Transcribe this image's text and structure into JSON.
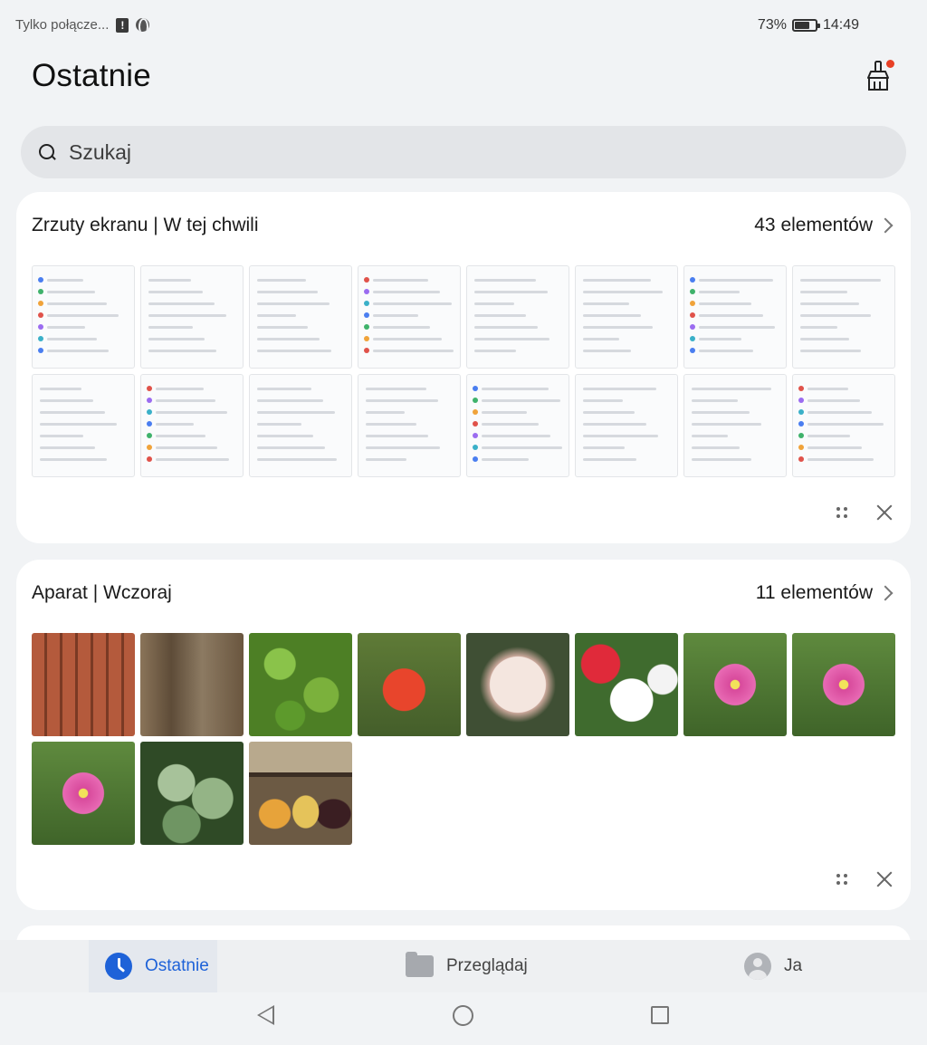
{
  "status_bar": {
    "carrier": "Tylko połącze...",
    "battery_percent": "73%",
    "battery_level": 0.73,
    "time": "14:49"
  },
  "header": {
    "title": "Ostatnie"
  },
  "search": {
    "placeholder": "Szukaj"
  },
  "albums": [
    {
      "title": "Zrzuty ekranu | W tej chwili",
      "count": "43 elementów",
      "thumbnails": [
        "screenshot",
        "screenshot",
        "screenshot",
        "screenshot",
        "screenshot",
        "screenshot",
        "screenshot",
        "screenshot",
        "screenshot",
        "screenshot",
        "screenshot",
        "screenshot",
        "screenshot",
        "screenshot",
        "screenshot",
        "screenshot"
      ]
    },
    {
      "title": "Aparat | Wczoraj",
      "count": "11 elementów",
      "thumbnails": [
        "photo-brick",
        "photo-wood",
        "photo-ivy",
        "photo-tomato",
        "photo-dahlia",
        "photo-petunia",
        "photo-rose",
        "photo-rose",
        "photo-rose",
        "photo-ivy2",
        "photo-jars"
      ]
    }
  ],
  "bottom_nav": {
    "items": [
      {
        "label": "Ostatnie",
        "icon": "clock-icon",
        "active": true
      },
      {
        "label": "Przeglądaj",
        "icon": "folder-icon",
        "active": false
      },
      {
        "label": "Ja",
        "icon": "avatar-icon",
        "active": false
      }
    ]
  },
  "colors": {
    "accent": "#1e62d8",
    "notification_dot": "#e84026"
  }
}
